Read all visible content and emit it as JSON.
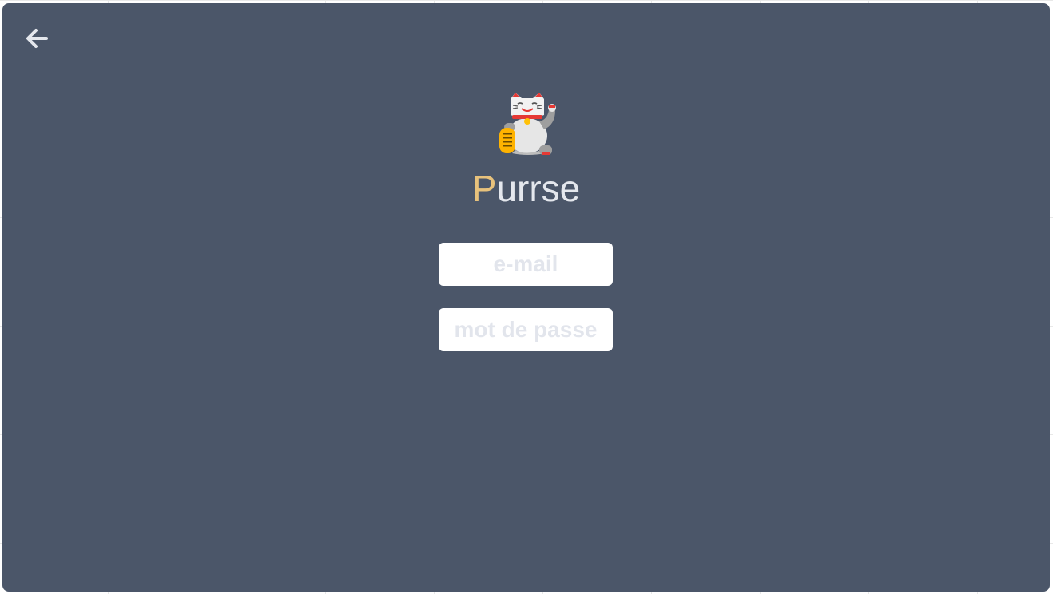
{
  "app": {
    "title_accent": "P",
    "title_rest": "urrse"
  },
  "icons": {
    "back": "arrow-left-icon",
    "logo": "maneki-neko-icon"
  },
  "form": {
    "email_placeholder": "e-mail",
    "email_value": "",
    "password_placeholder": "mot de passe",
    "password_value": ""
  },
  "colors": {
    "background": "#4b5669",
    "title": "#e4e7ed",
    "accent": "#e8c27c",
    "placeholder": "#e2e5ec"
  }
}
